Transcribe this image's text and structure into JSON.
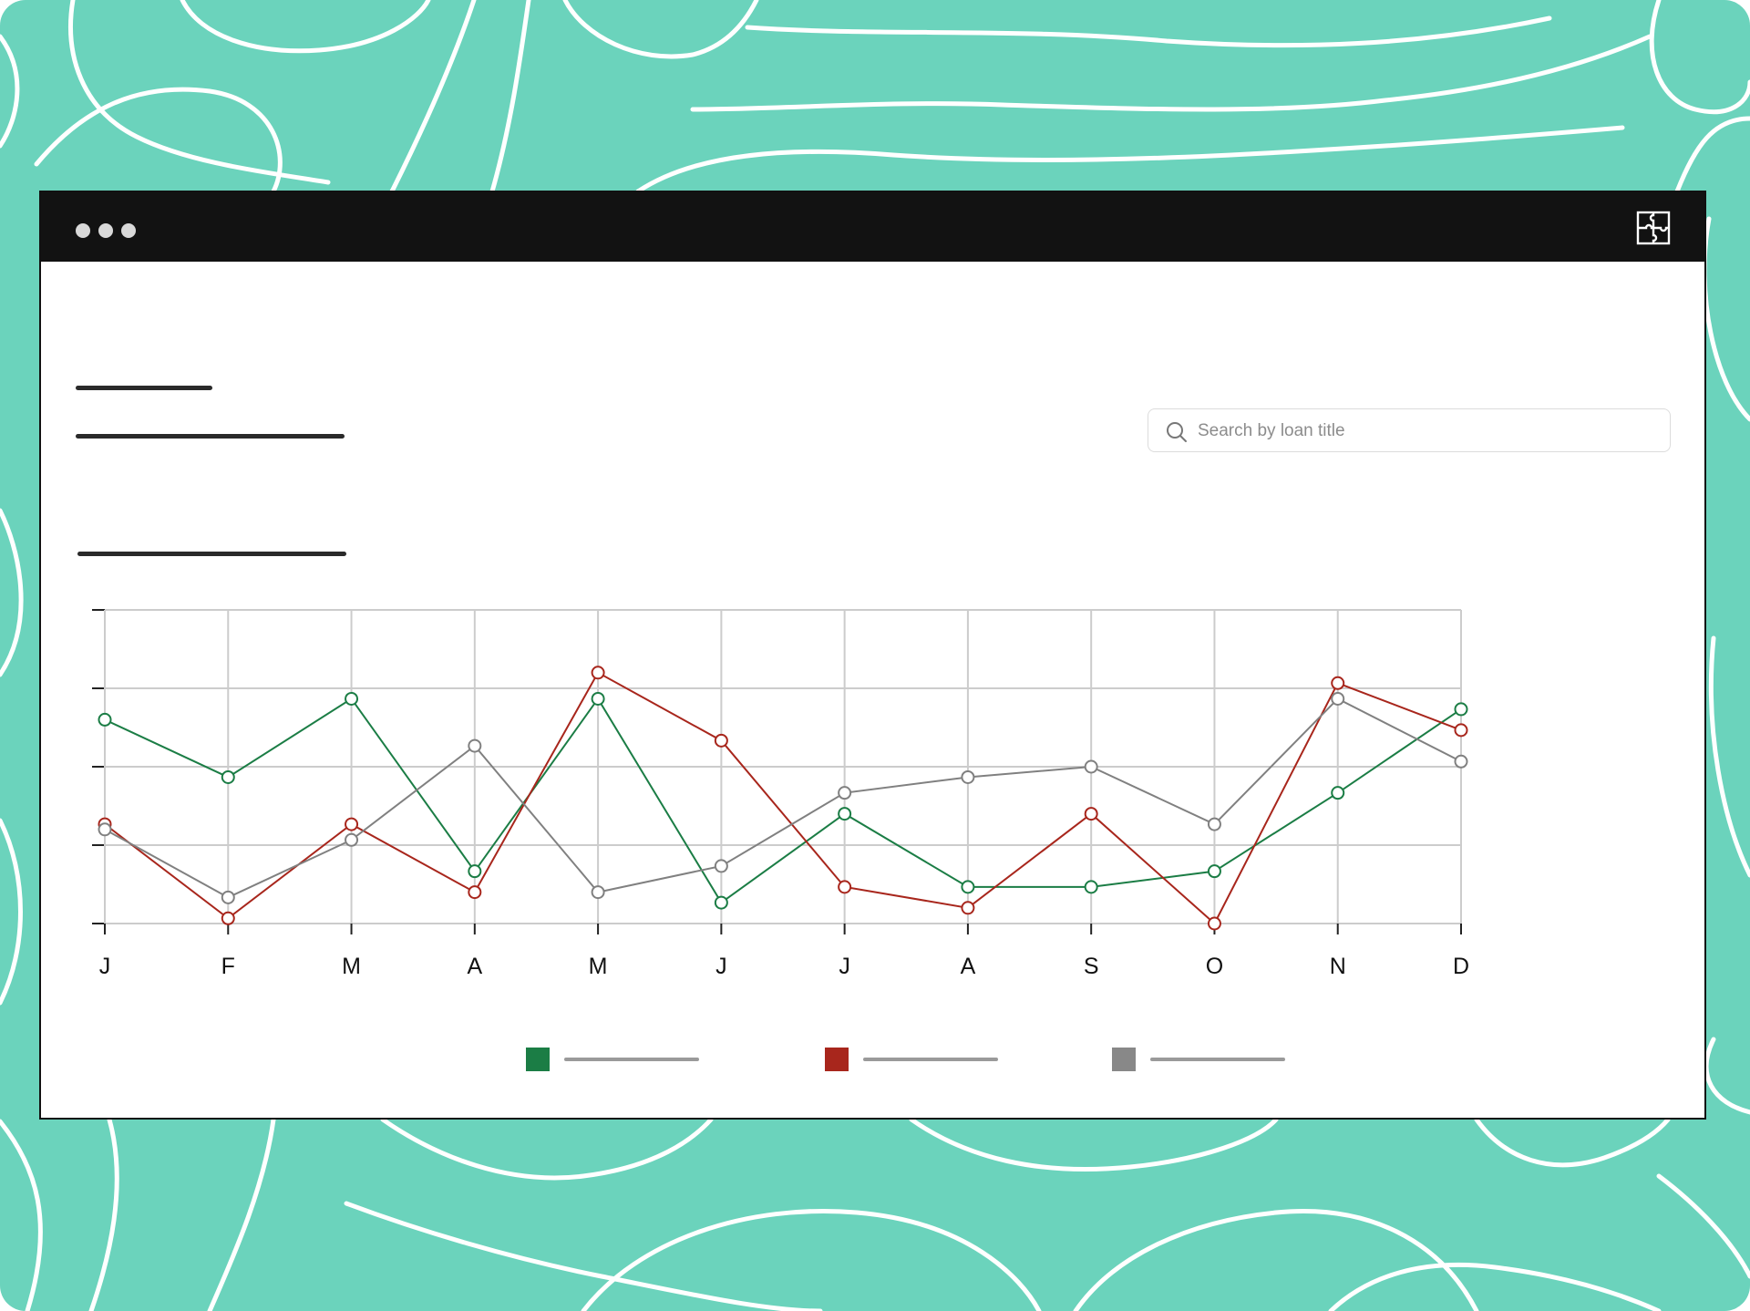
{
  "background": {
    "color": "#6bd3bc",
    "line_color": "#ffffff"
  },
  "window": {
    "titlebar_color": "#121212",
    "titlebar_icon": "puzzle-icon"
  },
  "search": {
    "placeholder": "Search by loan title",
    "icon": "search-icon",
    "value": ""
  },
  "chart_data": {
    "type": "line",
    "categories": [
      "J",
      "F",
      "M",
      "A",
      "M",
      "J",
      "J",
      "A",
      "S",
      "O",
      "N",
      "D"
    ],
    "ylim": [
      0,
      6
    ],
    "grid": true,
    "legend_position": "bottom-center",
    "series": [
      {
        "color": "#1b7d45",
        "values": [
          3.9,
          2.8,
          4.3,
          1.0,
          4.3,
          0.4,
          2.1,
          0.7,
          0.7,
          1.0,
          2.5,
          4.1
        ]
      },
      {
        "color": "#a8261c",
        "values": [
          1.9,
          0.1,
          1.9,
          0.6,
          4.8,
          3.5,
          0.7,
          0.3,
          2.1,
          0.0,
          4.6,
          3.7
        ]
      },
      {
        "color": "#808080",
        "values": [
          1.8,
          0.5,
          1.6,
          3.4,
          0.6,
          1.1,
          2.5,
          2.8,
          3.0,
          1.9,
          4.3,
          3.1
        ]
      }
    ]
  }
}
